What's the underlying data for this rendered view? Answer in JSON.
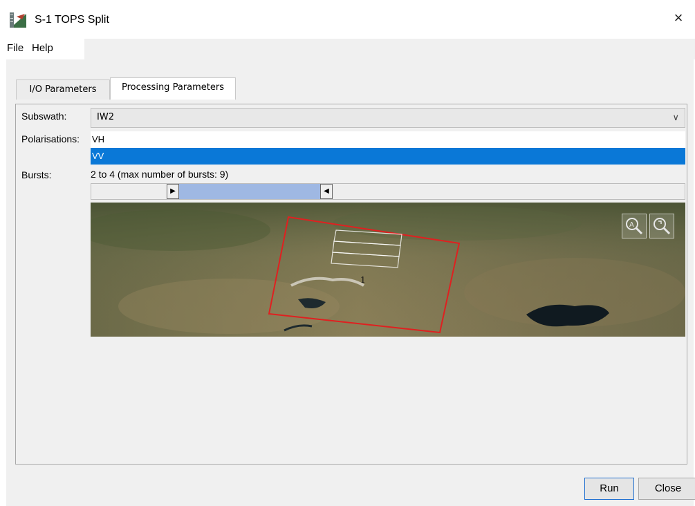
{
  "window": {
    "title": "S-1 TOPS Split"
  },
  "menu": {
    "items": [
      "File",
      "Help"
    ]
  },
  "tabs": [
    {
      "label": "I/O Parameters",
      "active": false
    },
    {
      "label": "Processing Parameters",
      "active": true
    }
  ],
  "form": {
    "subswath_label": "Subswath:",
    "subswath_value": "IW2",
    "polarisations_label": "Polarisations:",
    "polarisations": [
      {
        "label": "VH",
        "selected": false
      },
      {
        "label": "VV",
        "selected": true
      }
    ],
    "bursts_label": "Bursts:",
    "bursts_text": "2 to 4 (max number of bursts: 9)"
  },
  "map": {
    "burst_label": "1"
  },
  "buttons": {
    "run": "Run",
    "close": "Close"
  },
  "colors": {
    "selection": "#0a78d7",
    "footprint": "#e02020",
    "slider_fill": "#9fb8e3"
  }
}
